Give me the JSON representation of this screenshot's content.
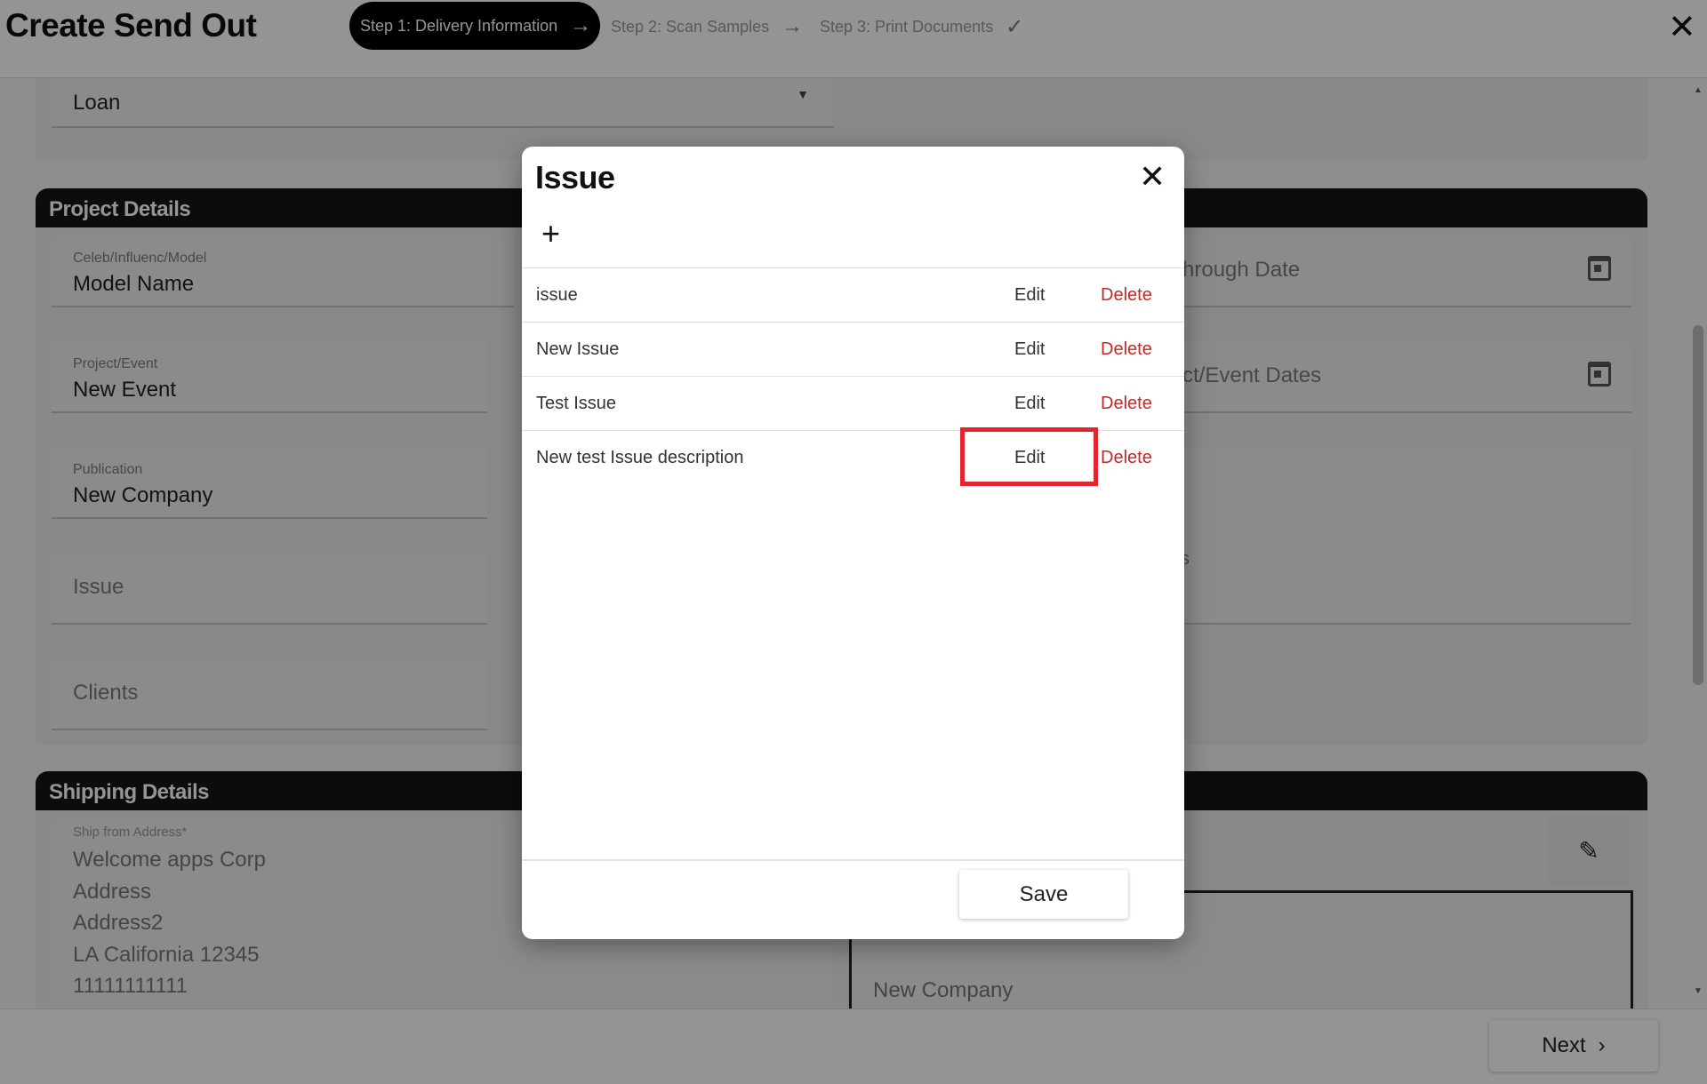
{
  "header": {
    "title": "Create Send Out",
    "steps": [
      {
        "label": "Step 1: Delivery Information"
      },
      {
        "label": "Step 2: Scan Samples"
      },
      {
        "label": "Step 3: Print Documents"
      }
    ]
  },
  "form": {
    "loan_value": "Loan",
    "project_details": {
      "heading": "Project Details",
      "celeb_label": "Celeb/Influenc/Model",
      "celeb_value": "Model Name",
      "project_label": "Project/Event",
      "project_value": "New Event",
      "publication_label": "Publication",
      "publication_value": "New Company",
      "issue_placeholder": "Issue",
      "clients_placeholder": "Clients",
      "through_date_partial": "hrough Date",
      "event_dates_partial": "ct/Event Dates",
      "notes_partial": "s"
    },
    "shipping_details": {
      "heading": "Shipping Details",
      "ship_from_label": "Ship from Address*",
      "ship_from_lines": [
        "Welcome apps Corp",
        "Address",
        "Address2",
        "LA California 12345",
        "11111111111"
      ],
      "ship_to_company": "New Company"
    }
  },
  "footer": {
    "next_label": "Next"
  },
  "dialog": {
    "title": "Issue",
    "items": [
      {
        "name": "issue",
        "edit": "Edit",
        "delete": "Delete"
      },
      {
        "name": "New Issue",
        "edit": "Edit",
        "delete": "Delete"
      },
      {
        "name": "Test Issue",
        "edit": "Edit",
        "delete": "Delete"
      },
      {
        "name": "New test Issue description",
        "edit": "Edit",
        "delete": "Delete"
      }
    ],
    "save_label": "Save"
  },
  "colors": {
    "accent_black": "#000000",
    "delete_red": "#c62828",
    "highlight_red": "#e3262e"
  }
}
